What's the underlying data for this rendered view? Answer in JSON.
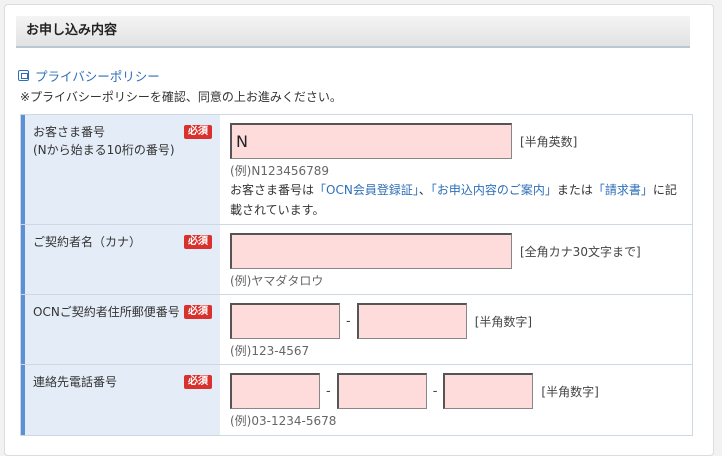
{
  "section": {
    "title": "お申し込み内容"
  },
  "privacy": {
    "link_label": "プライバシーポリシー",
    "notice": "※プライバシーポリシーを確認、同意の上お進みください。"
  },
  "required_label": "必須",
  "fields": {
    "customer_number": {
      "label": "お客さま番号",
      "sublabel": "(Nから始まる10桁の番号)",
      "value": "N",
      "hint": "[半角英数]",
      "example": "(例)N123456789",
      "desc_prefix": "お客さま番号は",
      "link1": "「OCN会員登録証」",
      "sep1": "、",
      "link2": "「お申込内容のご案内」",
      "sep2": "または",
      "link3": "「請求書」",
      "desc_suffix": "に記載されています。"
    },
    "contractor_name": {
      "label": "ご契約者名（カナ）",
      "value": "",
      "hint": "[全角カナ30文字まで]",
      "example": "(例)ヤマダタロウ"
    },
    "postal_code": {
      "label": "OCNご契約者住所郵便番号",
      "value1": "",
      "value2": "",
      "separator": "-",
      "hint": "[半角数字]",
      "example": "(例)123-4567"
    },
    "phone": {
      "label": "連絡先電話番号",
      "value1": "",
      "value2": "",
      "value3": "",
      "separator": "-",
      "hint": "[半角数字]",
      "example": "(例)03-1234-5678"
    }
  },
  "colors": {
    "input_bg": "#ffdcdc",
    "label_bg": "#e4edf7",
    "accent_border": "#5b8fd6",
    "required_badge": "#d9322e",
    "link": "#2e6fb7"
  }
}
